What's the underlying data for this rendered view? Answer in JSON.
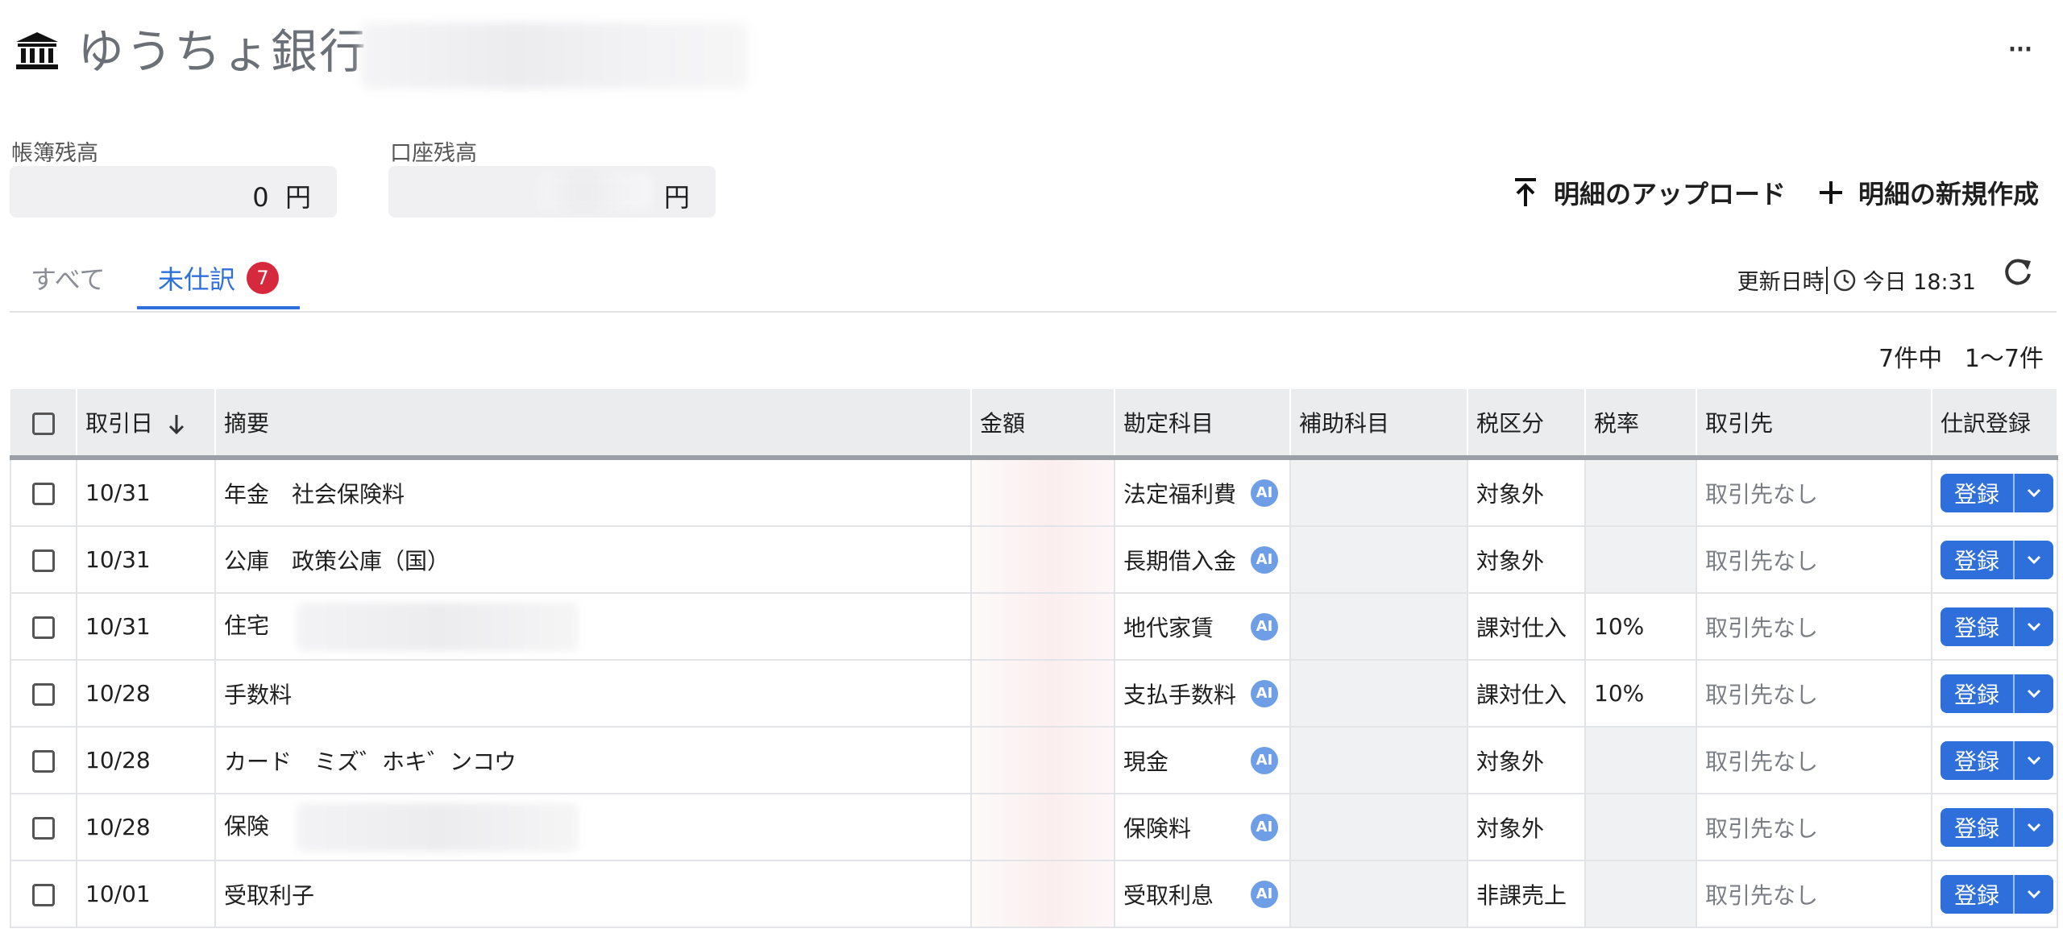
{
  "header": {
    "bank_name": "ゆうちょ銀行",
    "more_label": "···"
  },
  "balances": {
    "book_label": "帳簿残高",
    "book_value": "0",
    "book_unit": "円",
    "account_label": "口座残高",
    "account_unit": "円"
  },
  "actions": {
    "upload_label": "明細のアップロード",
    "new_label": "明細の新規作成"
  },
  "tabs": [
    {
      "label": "すべて"
    },
    {
      "label": "未仕訳",
      "badge": "7"
    }
  ],
  "updated": {
    "label": "更新日時",
    "value": "今日 18:31"
  },
  "pagination": {
    "total": "7件中",
    "range": "1〜7件"
  },
  "table": {
    "headers": {
      "date": "取引日",
      "description": "摘要",
      "amount": "金額",
      "account": "勘定科目",
      "sub_account": "補助科目",
      "tax_category": "税区分",
      "tax_rate": "税率",
      "partner": "取引先",
      "register": "仕訳登録"
    },
    "ai_label": "AI",
    "register_label": "登録",
    "rows": [
      {
        "date": "10/31",
        "description": "年金　社会保険料",
        "account": "法定福利費",
        "tax_category": "対象外",
        "tax_rate": "",
        "partner": "取引先なし"
      },
      {
        "date": "10/31",
        "description": "公庫　政策公庫（国）",
        "account": "長期借入金",
        "tax_category": "対象外",
        "tax_rate": "",
        "partner": "取引先なし"
      },
      {
        "date": "10/31",
        "description": "住宅",
        "account": "地代家賃",
        "tax_category": "課対仕入",
        "tax_rate": "10%",
        "partner": "取引先なし"
      },
      {
        "date": "10/28",
        "description": "手数料",
        "account": "支払手数料",
        "tax_category": "課対仕入",
        "tax_rate": "10%",
        "partner": "取引先なし"
      },
      {
        "date": "10/28",
        "description": "カード　ミズ゛ホキ゛ンコウ",
        "account": "現金",
        "tax_category": "対象外",
        "tax_rate": "",
        "partner": "取引先なし"
      },
      {
        "date": "10/28",
        "description": "保険",
        "account": "保険料",
        "tax_category": "対象外",
        "tax_rate": "",
        "partner": "取引先なし"
      },
      {
        "date": "10/01",
        "description": "受取利子",
        "account": "受取利息",
        "tax_category": "非課売上",
        "tax_rate": "",
        "partner": "取引先なし"
      }
    ]
  }
}
